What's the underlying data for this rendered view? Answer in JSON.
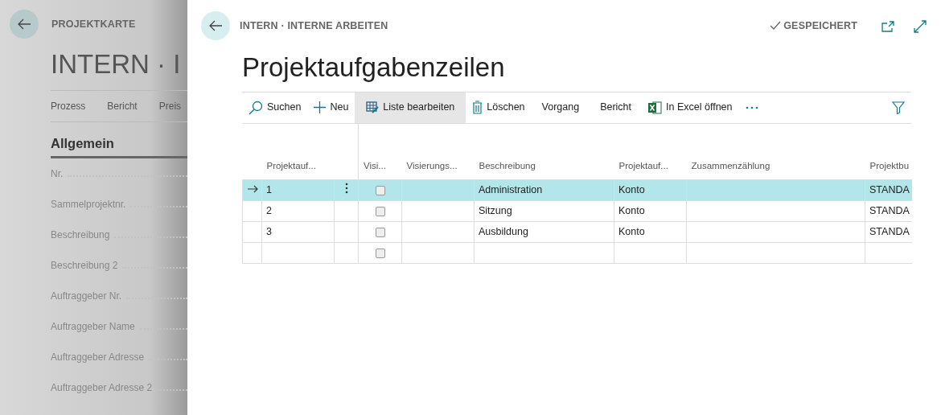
{
  "background_page": {
    "caption": "PROJEKTKARTE",
    "title": "INTERN · I",
    "actions": [
      "Prozess",
      "Bericht",
      "Preis"
    ],
    "section": "Allgemein",
    "fields": [
      "Nr.",
      "Sammelprojektnr.",
      "Beschreibung",
      "Beschreibung 2",
      "Auftraggeber Nr.",
      "Auftraggeber Name",
      "Auftraggeber Adresse",
      "Auftraggeber Adresse 2"
    ]
  },
  "page": {
    "caption": "INTERN · INTERNE ARBEITEN",
    "status": "GESPEICHERT",
    "title": "Projektaufgabenzeilen"
  },
  "toolbar": [
    {
      "kind": "search",
      "label": "Suchen",
      "selected": false
    },
    {
      "kind": "new",
      "label": "Neu",
      "selected": false
    },
    {
      "kind": "edit",
      "label": "Liste bearbeiten",
      "selected": true
    },
    {
      "kind": "delete",
      "label": "Löschen",
      "selected": false
    },
    {
      "kind": "plain",
      "label": "Vorgang",
      "selected": false
    },
    {
      "kind": "plain",
      "label": "Bericht",
      "selected": false
    },
    {
      "kind": "excel",
      "label": "In Excel öffnen",
      "selected": false
    }
  ],
  "table": {
    "columns": [
      "Projektauf...",
      "Visi...",
      "Visierungs...",
      "Beschreibung",
      "Projektauf...",
      "Zusammenzählung",
      "Projektbu"
    ],
    "rows": [
      {
        "selected": true,
        "checked": false,
        "cells": [
          "1",
          "",
          "",
          "Administration",
          "Konto",
          "",
          "STANDA"
        ]
      },
      {
        "selected": false,
        "checked": false,
        "cells": [
          "2",
          "",
          "",
          "Sitzung",
          "Konto",
          "",
          "STANDA"
        ]
      },
      {
        "selected": false,
        "checked": false,
        "cells": [
          "3",
          "",
          "",
          "Ausbildung",
          "Konto",
          "",
          "STANDA"
        ]
      },
      {
        "selected": false,
        "checked": false,
        "cells": [
          "",
          "",
          "",
          "",
          "",
          "",
          ""
        ]
      }
    ]
  }
}
